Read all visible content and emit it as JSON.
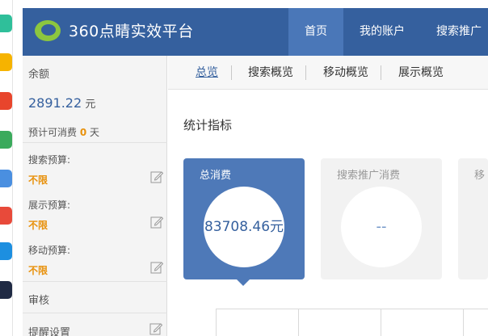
{
  "dock": {
    "icons": [
      {
        "name": "teal-app-icon",
        "color": "#2fbf9a"
      },
      {
        "name": "star-app-icon",
        "color": "#f6b300"
      },
      {
        "name": "weibo-icon",
        "color": "#e8452c"
      },
      {
        "name": "mail-app-icon",
        "color": "#3aaa5c"
      },
      {
        "name": "note-app-icon",
        "color": "#4a8fe0"
      },
      {
        "name": "red-app-icon",
        "color": "#e84a3a"
      },
      {
        "name": "blue-app-icon",
        "color": "#1d8fe0"
      },
      {
        "name": "dark-app-icon",
        "color": "#1f2a44"
      }
    ]
  },
  "header": {
    "brand": "360点睛实效平台",
    "nav": [
      {
        "label": "首页",
        "active": true
      },
      {
        "label": "我的账户",
        "active": false
      },
      {
        "label": "搜索推广",
        "active": false
      }
    ],
    "colors": {
      "bar": "#35609e",
      "active": "#4a77b8"
    }
  },
  "side": {
    "balance_label": "余额",
    "balance_value": "2891.22",
    "balance_unit": "元",
    "days_label": "预计可消费",
    "days_value": "0",
    "days_unit": "天",
    "budgets": [
      {
        "label": "搜索预算:",
        "value": "不限"
      },
      {
        "label": "展示预算:",
        "value": "不限"
      },
      {
        "label": "移动预算:",
        "value": "不限"
      }
    ],
    "audit_label": "审核",
    "reminder_label": "提醒设置"
  },
  "subtabs": [
    "总览",
    "搜索概览",
    "移动概览",
    "展示概览"
  ],
  "main": {
    "section_title": "统计指标",
    "cards": [
      {
        "title": "总消费",
        "value": "83708.46元"
      },
      {
        "title": "搜索推广消费",
        "value": "--"
      },
      {
        "title": "移"
      }
    ]
  }
}
